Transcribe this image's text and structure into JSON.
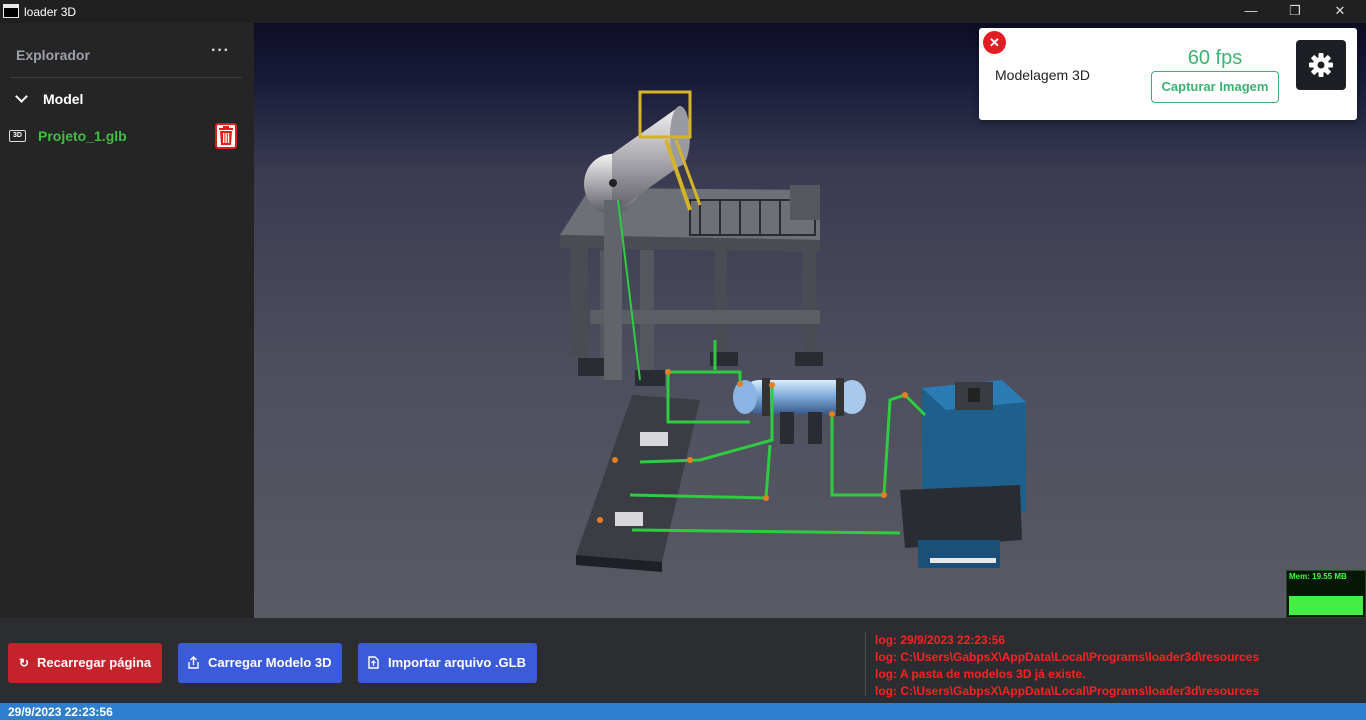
{
  "window": {
    "title": "loader 3D",
    "minimize_glyph": "—",
    "restore_glyph": "❐",
    "close_glyph": "✕"
  },
  "sidebar": {
    "title": "Explorador",
    "more_glyph": "···",
    "section_label": "Model",
    "file": {
      "badge": "3D",
      "name": "Projeto_1.glb"
    }
  },
  "viewer_panel": {
    "title": "Modelagem 3D",
    "fps_label": "60 fps",
    "capture_label": "Capturar Imagem",
    "close_glyph": "✕"
  },
  "memory": {
    "label": "Mem: 19.55 MB",
    "fill_fraction": 1.0
  },
  "actions": {
    "reload_label": "Recarregar página",
    "reload_icon": "↻",
    "load_label": "Carregar Modelo 3D",
    "import_label": "Importar arquivo .GLB"
  },
  "logs": [
    "log: 29/9/2023 22:23:56",
    "log: C:\\Users\\GabpsX\\AppData\\Local\\Programs\\loader3d\\resources",
    "log: A pasta de modelos 3D já existe.",
    "log: C:\\Users\\GabpsX\\AppData\\Local\\Programs\\loader3d\\resources"
  ],
  "status": {
    "timestamp": "29/9/2023 22:23:56"
  },
  "colors": {
    "accent_green": "#3cb371",
    "danger_red": "#c4232c",
    "primary_blue": "#3b5bdb",
    "status_blue": "#2f7fd1",
    "log_red": "#ff2020"
  }
}
